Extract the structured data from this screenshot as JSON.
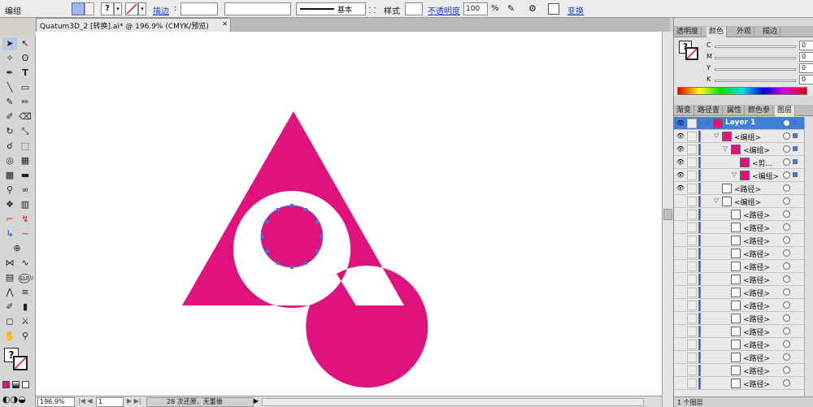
{
  "control_bar": {
    "selection_label": "编组",
    "stroke_label": "描边",
    "stroke_style": "基本",
    "style_label": "样式",
    "opacity_label": "不透明度",
    "opacity_value": "100",
    "opacity_unit": "%",
    "transform_label": "变换"
  },
  "document": {
    "tab_title": "Quatum3D_2 [转换].ai* @ 196.9% (CMYK/预览)",
    "tab_close": "✕"
  },
  "status_bar": {
    "zoom": "196.9%",
    "artboard": "1",
    "undo_info": "28 次还原，无重做"
  },
  "color_panel": {
    "tabs": [
      "透明度",
      "颜色",
      "外观",
      "描边"
    ],
    "active_tab": "颜色",
    "channels": [
      {
        "name": "C",
        "value": "0"
      },
      {
        "name": "M",
        "value": "0"
      },
      {
        "name": "Y",
        "value": "0"
      },
      {
        "name": "K",
        "value": "0"
      }
    ],
    "unit": "%"
  },
  "layers_panel": {
    "tabs": [
      "渐变",
      "路径查",
      "属性",
      "颜色参",
      "图层"
    ],
    "active_tab": "图层",
    "rows": [
      {
        "name": "Layer 1",
        "indent": 0,
        "eye": true,
        "selected": true
      },
      {
        "name": "<编组>",
        "indent": 1,
        "eye": true
      },
      {
        "name": "<编组>",
        "indent": 2,
        "eye": true
      },
      {
        "name": "<剪...",
        "indent": 3,
        "eye": true
      },
      {
        "name": "<编组>",
        "indent": 3,
        "eye": true
      },
      {
        "name": "<路径>",
        "indent": 1,
        "eye": true
      },
      {
        "name": "<编组>",
        "indent": 1,
        "eye": false
      },
      {
        "name": "<路径>",
        "indent": 2,
        "eye": false
      },
      {
        "name": "<路径>",
        "indent": 2,
        "eye": false
      },
      {
        "name": "<路径>",
        "indent": 2,
        "eye": false
      },
      {
        "name": "<路径>",
        "indent": 2,
        "eye": false
      },
      {
        "name": "<路径>",
        "indent": 2,
        "eye": false
      },
      {
        "name": "<路径>",
        "indent": 2,
        "eye": false
      },
      {
        "name": "<路径>",
        "indent": 2,
        "eye": false
      },
      {
        "name": "<路径>",
        "indent": 2,
        "eye": false
      },
      {
        "name": "<路径>",
        "indent": 2,
        "eye": false
      },
      {
        "name": "<路径>",
        "indent": 2,
        "eye": false
      },
      {
        "name": "<路径>",
        "indent": 2,
        "eye": false
      },
      {
        "name": "<路径>",
        "indent": 2,
        "eye": false
      },
      {
        "name": "<路径>",
        "indent": 2,
        "eye": false
      },
      {
        "name": "<路径>",
        "indent": 2,
        "eye": false
      }
    ],
    "footer_label": "1 个图层"
  },
  "colors": {
    "magenta": "#e0137e",
    "selection_blue": "#4f6fd6",
    "layer_selected": "#3d7fd9"
  }
}
